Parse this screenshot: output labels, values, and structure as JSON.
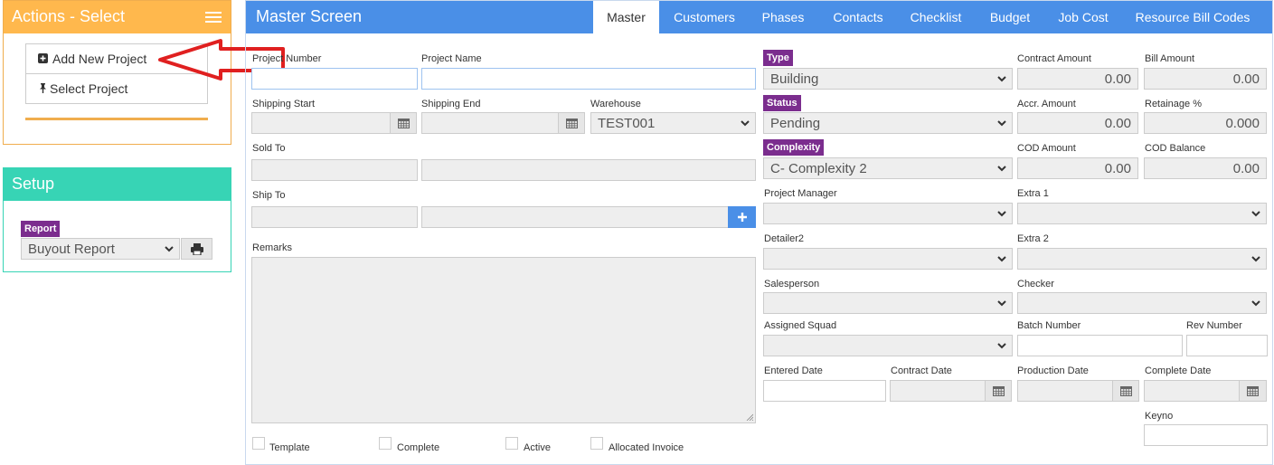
{
  "actions": {
    "title": "Actions - Select",
    "items": [
      {
        "label": "Add New Project"
      },
      {
        "label": "Select Project"
      }
    ]
  },
  "setup": {
    "title": "Setup",
    "report_tag": "Report",
    "report_value": "Buyout Report"
  },
  "master": {
    "title": "Master Screen",
    "tabs": [
      {
        "label": "Master"
      },
      {
        "label": "Customers"
      },
      {
        "label": "Phases"
      },
      {
        "label": "Contacts"
      },
      {
        "label": "Checklist"
      },
      {
        "label": "Budget"
      },
      {
        "label": "Job Cost"
      },
      {
        "label": "Resource Bill Codes"
      }
    ],
    "labels": {
      "project_number": "Project Number",
      "project_name": "Project Name",
      "shipping_start": "Shipping Start",
      "shipping_end": "Shipping End",
      "warehouse": "Warehouse",
      "sold_to": "Sold To",
      "ship_to": "Ship To",
      "remarks": "Remarks",
      "type": "Type",
      "status": "Status",
      "complexity": "Complexity",
      "contract_amount": "Contract Amount",
      "bill_amount": "Bill Amount",
      "accr_amount": "Accr. Amount",
      "retainage": "Retainage %",
      "cod_amount": "COD Amount",
      "cod_balance": "COD Balance",
      "project_manager": "Project Manager",
      "extra1": "Extra 1",
      "detailer2": "Detailer2",
      "extra2": "Extra 2",
      "salesperson": "Salesperson",
      "checker": "Checker",
      "assigned_squad": "Assigned Squad",
      "batch_number": "Batch Number",
      "rev_number": "Rev Number",
      "entered_date": "Entered Date",
      "contract_date": "Contract Date",
      "production_date": "Production Date",
      "complete_date": "Complete Date",
      "keyno": "Keyno"
    },
    "values": {
      "warehouse": "TEST001",
      "type": "Building",
      "status": "Pending",
      "complexity": "C- Complexity 2",
      "contract_amount": "0.00",
      "bill_amount": "0.00",
      "accr_amount": "0.00",
      "retainage": "0.000",
      "cod_amount": "0.00",
      "cod_balance": "0.00"
    },
    "checkboxes": [
      {
        "label": "Template"
      },
      {
        "label": "Complete"
      },
      {
        "label": "Active"
      },
      {
        "label": "Allocated Invoice"
      }
    ]
  },
  "colors": {
    "actions_header": "#ffb84d",
    "setup_header": "#37d4b5",
    "master_header": "#4a8fe7",
    "tag": "#7b2d8e",
    "arrow": "#e02020"
  }
}
